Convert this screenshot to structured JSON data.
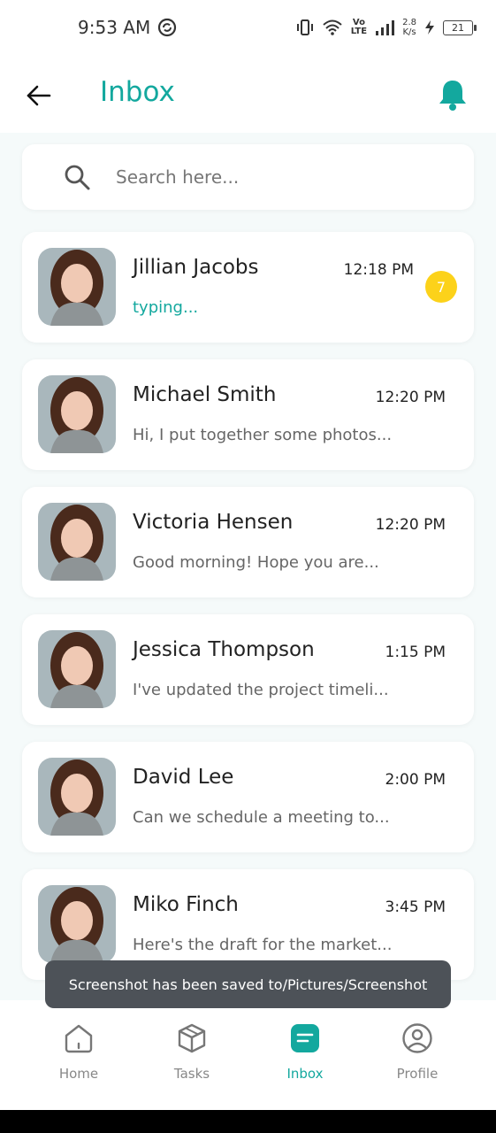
{
  "status_bar": {
    "time": "9:53 AM",
    "net_speed_value": "2.8",
    "net_speed_unit": "K/s",
    "volte_top": "Vo",
    "volte_bottom": "LTE",
    "battery": "21"
  },
  "header": {
    "title": "Inbox",
    "back_icon": "arrow-left-icon",
    "bell_icon": "bell-icon"
  },
  "search": {
    "placeholder": "Search here..."
  },
  "chats": [
    {
      "name": "Jillian Jacobs",
      "time": "12:18 PM",
      "preview": "typing...",
      "unread": "7"
    },
    {
      "name": "Michael Smith",
      "time": "12:20 PM",
      "preview": "Hi, I put together some photos..."
    },
    {
      "name": "Victoria Hensen",
      "time": "12:20 PM",
      "preview": "Good morning! Hope you are..."
    },
    {
      "name": "Jessica Thompson",
      "time": "1:15 PM",
      "preview": "I've updated the project timeli..."
    },
    {
      "name": "David Lee",
      "time": "2:00 PM",
      "preview": "Can we schedule a meeting to..."
    },
    {
      "name": "Miko Finch",
      "time": "3:45 PM",
      "preview": "Here's the draft for the market..."
    }
  ],
  "toast": {
    "text": "Screenshot has been saved to/Pictures/Screenshot"
  },
  "bottom_nav": {
    "items": [
      {
        "label": "Home",
        "icon": "home-icon"
      },
      {
        "label": "Tasks",
        "icon": "box-icon"
      },
      {
        "label": "Inbox",
        "icon": "inbox-icon",
        "active": true
      },
      {
        "label": "Profile",
        "icon": "user-circle-icon"
      }
    ]
  },
  "colors": {
    "accent": "#13a89e",
    "badge": "#fcd21a",
    "background": "#f5fafa",
    "toast": "#4d5258"
  }
}
